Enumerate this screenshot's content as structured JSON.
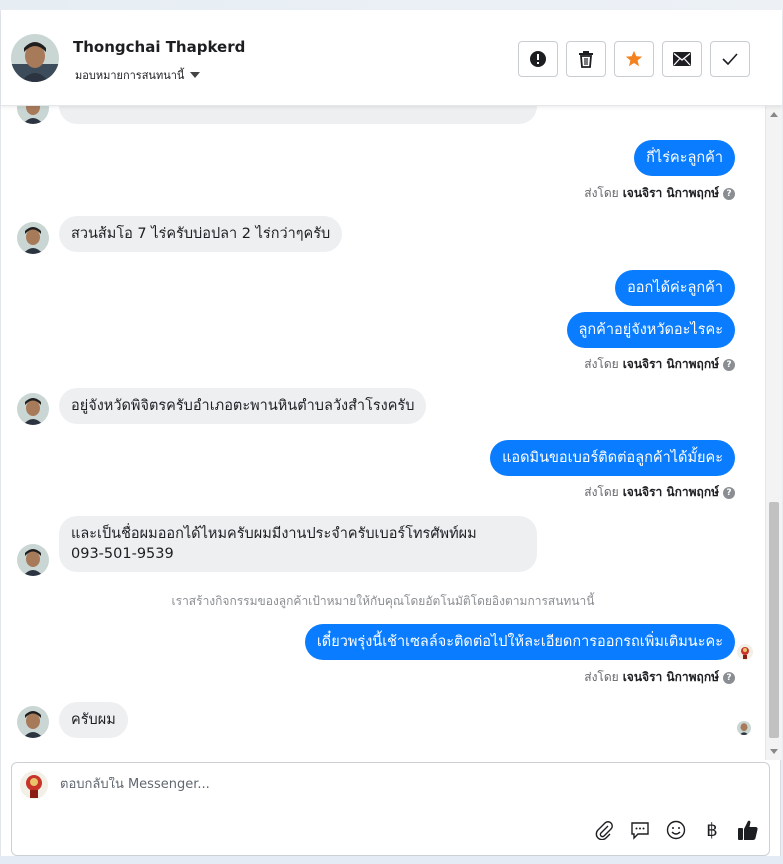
{
  "header": {
    "contact_name": "Thongchai Thapkerd",
    "assign_label": "มอบหมายการสนทนานี้",
    "actions": [
      "spam-button",
      "delete-button",
      "star-button",
      "mark-unread-button",
      "done-button"
    ]
  },
  "colors": {
    "outgoing": "#0a7cff",
    "incoming": "#eeeff1",
    "star": "#f4821f"
  },
  "messages": {
    "m1": "กี่ไร่คะลูกค้า",
    "m2": "สวนส้มโอ 7 ไร่ครับบ่อปลา 2 ไร่กว่าๆครับ",
    "m3": "ออกได้ค่ะลูกค้า",
    "m4": "ลูกค้าอยู่จังหวัดอะไรคะ",
    "m5": "อยู่จังหวัดพิจิตรครับอำเภอตะพานหินตำบลวังสำโรงครับ",
    "m6": "แอดมินขอเบอร์ติดต่อลูกค้าได้มั้ยคะ",
    "m7_line1": "และเป็นชื่อผมออกได้ไหมครับผมมีงานประจำครับเบอร์โทรศัพท์ผม",
    "m7_line2": "093-501-9539",
    "m8": "เดี๋ยวพรุ่งนี้เช้าเซลล์จะติดต่อไปให้ละเอียดการออกรถเพิ่มเติมนะคะ",
    "m9": "ครับผม"
  },
  "sent_by": {
    "prefix": "ส่งโดย",
    "name": "เจนจิรา นิกาพฤกษ์",
    "help": "?"
  },
  "system_note": "เราสร้างกิจกรรมของลูกค้าเป้าหมายให้กับคุณโดยอัตโนมัติโดยอิงตามการสนทนานี้",
  "composer": {
    "placeholder": "ตอบกลับใน Messenger...",
    "tools": [
      "attachment-icon",
      "saved-reply-icon",
      "emoji-icon",
      "baht-payment-icon",
      "like-icon"
    ],
    "baht_symbol": "฿"
  }
}
